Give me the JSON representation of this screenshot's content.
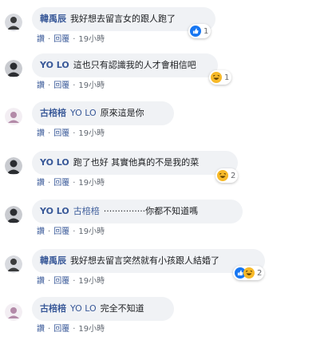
{
  "actions": {
    "like": "讚",
    "reply": "回覆"
  },
  "comments": [
    {
      "author": "韓禹辰",
      "mention": "",
      "text": "我好想去留言女的跟人跑了",
      "time": "19小時",
      "reaction": "like",
      "count": "1"
    },
    {
      "author": "YO LO",
      "mention": "",
      "text": "這也只有認識我的人才會相信吧",
      "time": "19小時",
      "reaction": "haha",
      "count": "1"
    },
    {
      "author": "古棓棓",
      "mention": "YO LO",
      "text": "原來這是你",
      "time": "19小時",
      "reaction": "",
      "count": ""
    },
    {
      "author": "YO LO",
      "mention": "",
      "text": "跑了也好 其實他真的不是我的菜",
      "time": "19小時",
      "reaction": "haha",
      "count": "2"
    },
    {
      "author": "YO LO",
      "mention": "古棓棓",
      "text": "···············你都不知道嗎",
      "time": "19小時",
      "reaction": "",
      "count": ""
    },
    {
      "author": "韓禹辰",
      "mention": "",
      "text": "我好想去留言突然就有小孩跟人結婚了",
      "time": "19小時",
      "reaction": "like+haha",
      "count": "2"
    },
    {
      "author": "古棓棓",
      "mention": "YO LO",
      "text": "完全不知道",
      "time": "19小時",
      "reaction": "",
      "count": ""
    }
  ],
  "colors": {
    "link": "#385898",
    "bubble": "#f0f2f5",
    "like": "#1877f2",
    "haha": "#f7b928"
  }
}
